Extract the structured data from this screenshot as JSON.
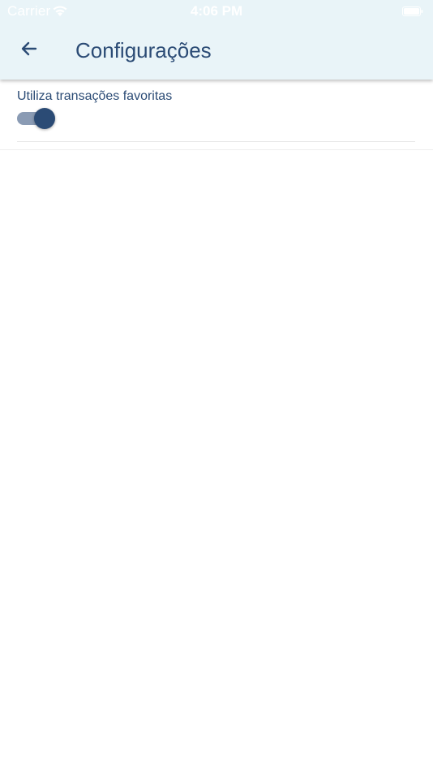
{
  "status_bar": {
    "carrier": "Carrier",
    "time": "4:06 PM",
    "wifi_icon": "wifi-icon",
    "battery_icon": "battery-icon"
  },
  "header": {
    "back_icon": "arrow-left-icon",
    "title": "Configurações"
  },
  "settings": [
    {
      "label": "Utiliza transações favoritas",
      "toggle_on": true
    }
  ],
  "colors": {
    "header_bg": "#e9f4f8",
    "primary": "#2b4b75",
    "toggle_track": "#8a9bb4",
    "background": "#ffffff"
  }
}
